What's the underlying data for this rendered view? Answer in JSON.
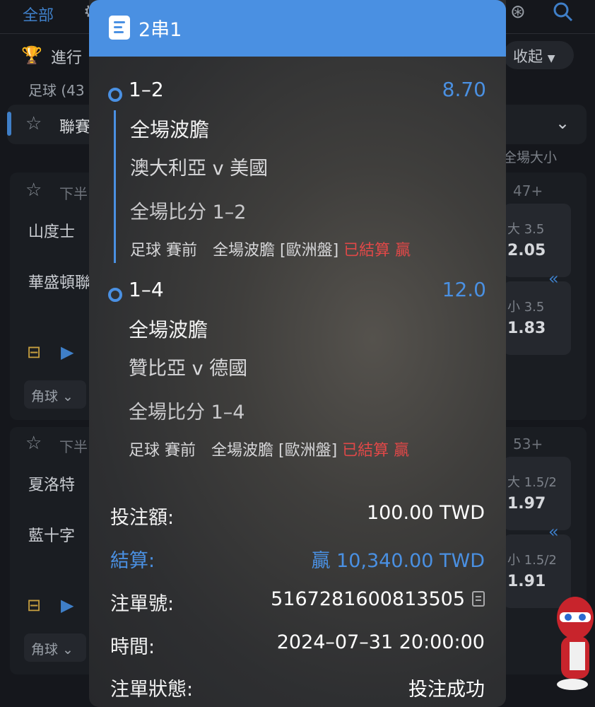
{
  "background": {
    "tab_all": "全部",
    "ongoing_label": "進行",
    "collapse_label": "收起",
    "sport_label": "足球 (43",
    "league_label": "聯賽",
    "column_header": "全場大小",
    "matches": [
      {
        "period": "下半",
        "count": "47+",
        "home": "山度士",
        "away": "華盛頓聯",
        "over_label": "大 3.5",
        "over_odds": "2.05",
        "under_label": "小 3.5",
        "under_odds": "1.83",
        "corner_chip": "角球"
      },
      {
        "period": "下半",
        "count": "53+",
        "home": "夏洛特",
        "away": "藍十字",
        "over_label": "大 1.5/2",
        "over_odds": "1.97",
        "under_label": "小 1.5/2",
        "under_odds": "1.91",
        "corner_chip": "角球"
      }
    ]
  },
  "modal": {
    "title": "2串1",
    "legs": [
      {
        "pick": "1–2",
        "odds": "8.70",
        "market": "全場波膽",
        "match": "澳大利亞 v 美國",
        "score_line": "全場比分 1–2",
        "meta": "足球 賽前　全場波膽 [歐洲盤]",
        "status": "已結算 贏"
      },
      {
        "pick": "1–4",
        "odds": "12.0",
        "market": "全場波膽",
        "match": "贊比亞 v 德國",
        "score_line": "全場比分 1–4",
        "meta": "足球 賽前　全場波膽 [歐洲盤]",
        "status": "已結算 贏"
      }
    ],
    "summary": {
      "stake_label": "投注額:",
      "stake_value": "100.00 TWD",
      "settle_label": "結算:",
      "settle_value": "贏 10,340.00 TWD",
      "ticket_label": "注單號:",
      "ticket_value": "5167281600813505",
      "time_label": "時間:",
      "time_value": "2024–07–31 20:00:00",
      "status_label": "注單狀態:",
      "status_value": "投注成功"
    }
  },
  "colors": {
    "accent_blue": "#4a90e2",
    "win_red": "#e04848"
  },
  "icons": [
    "copy-icon",
    "document-icon",
    "search-icon",
    "trophy-icon",
    "star-icon",
    "chevron-down-icon"
  ]
}
